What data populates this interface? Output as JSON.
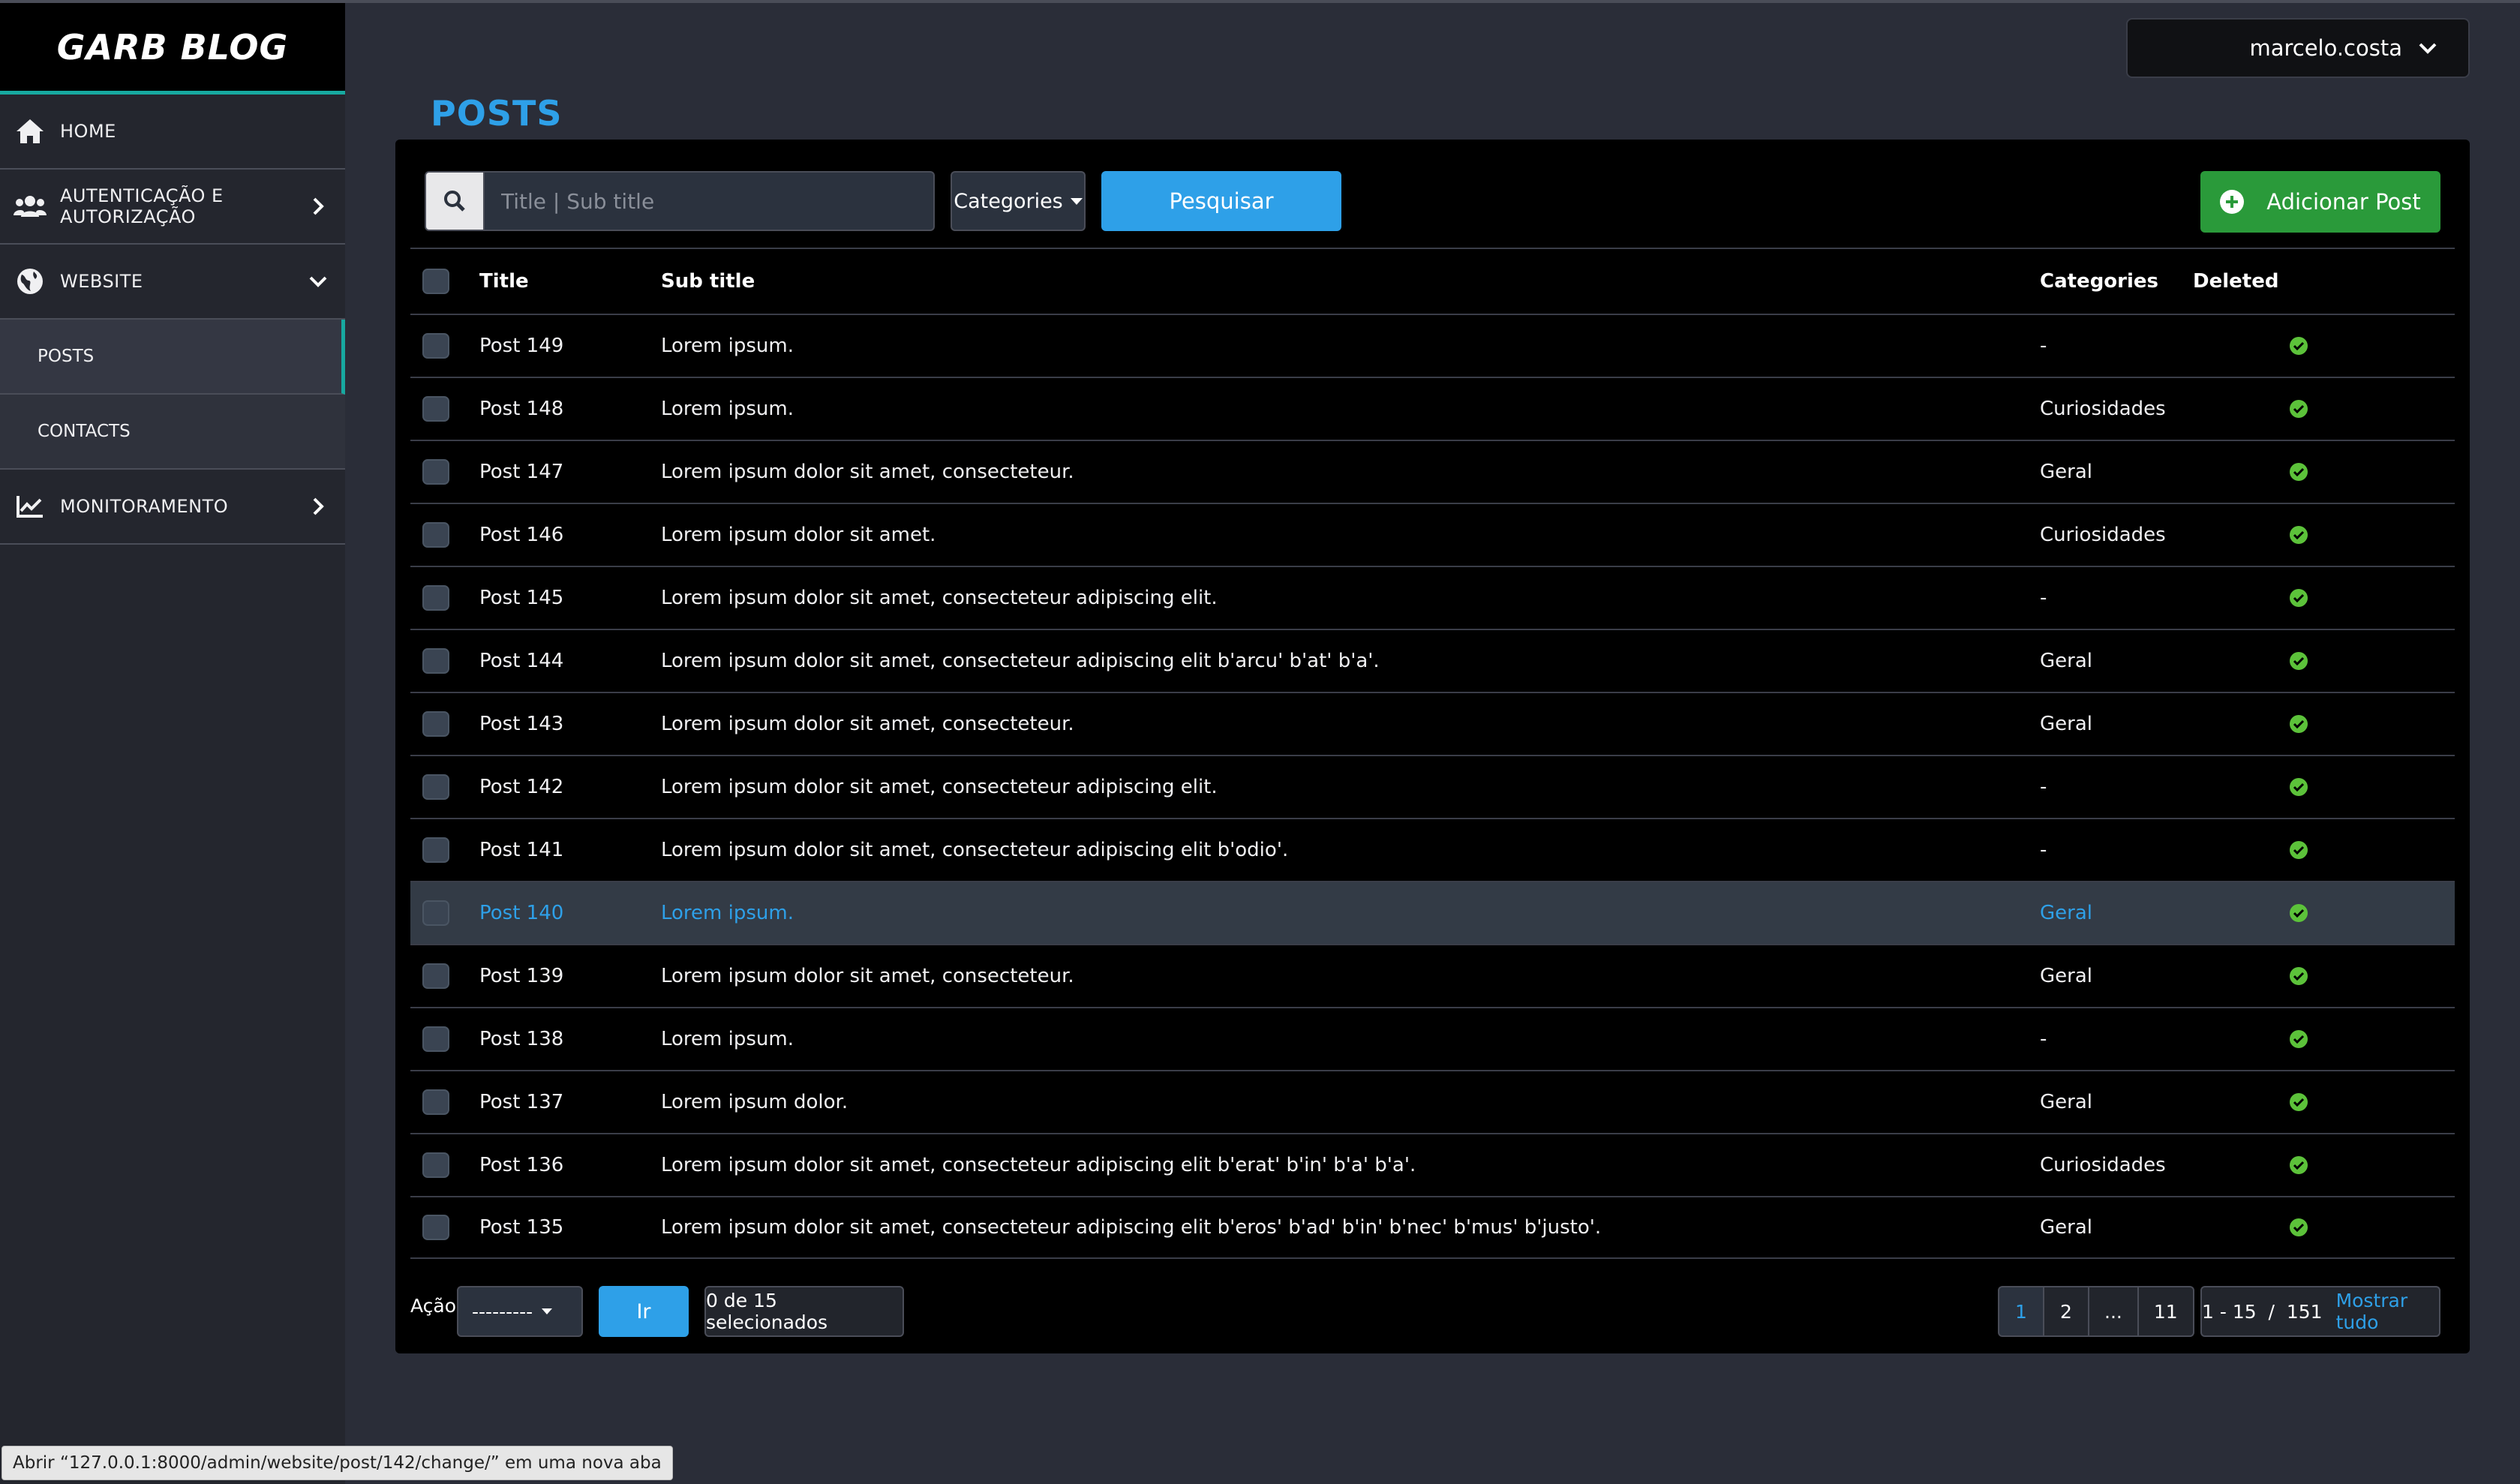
{
  "brand": "GARB BLOG",
  "sidebar": {
    "items": [
      {
        "label": "HOME",
        "icon": "home-icon"
      },
      {
        "label": "AUTENTICAÇÃO E AUTORIZAÇÃO",
        "icon": "users-icon"
      },
      {
        "label": "WEBSITE",
        "icon": "globe-icon"
      },
      {
        "label": "MONITORAMENTO",
        "icon": "chart-line-icon"
      }
    ],
    "website_sub": [
      {
        "label": "POSTS",
        "active": true
      },
      {
        "label": "CONTACTS",
        "active": false
      }
    ]
  },
  "user": {
    "name": "marcelo.costa"
  },
  "page_title": "POSTS",
  "toolbar": {
    "search_placeholder": "Title | Sub title",
    "categories_label": "Categories",
    "search_button": "Pesquisar",
    "add_button": "Adicionar Post"
  },
  "table": {
    "headers": {
      "title": "Title",
      "subtitle": "Sub title",
      "categories": "Categories",
      "deleted": "Deleted"
    },
    "rows": [
      {
        "title": "Post 149",
        "subtitle": "Lorem ipsum.",
        "category": "-"
      },
      {
        "title": "Post 148",
        "subtitle": "Lorem ipsum.",
        "category": "Curiosidades"
      },
      {
        "title": "Post 147",
        "subtitle": "Lorem ipsum dolor sit amet, consecteteur.",
        "category": "Geral"
      },
      {
        "title": "Post 146",
        "subtitle": "Lorem ipsum dolor sit amet.",
        "category": "Curiosidades"
      },
      {
        "title": "Post 145",
        "subtitle": "Lorem ipsum dolor sit amet, consecteteur adipiscing elit.",
        "category": "-"
      },
      {
        "title": "Post 144",
        "subtitle": "Lorem ipsum dolor sit amet, consecteteur adipiscing elit b'arcu' b'at' b'a'.",
        "category": "Geral"
      },
      {
        "title": "Post 143",
        "subtitle": "Lorem ipsum dolor sit amet, consecteteur.",
        "category": "Geral"
      },
      {
        "title": "Post 142",
        "subtitle": "Lorem ipsum dolor sit amet, consecteteur adipiscing elit.",
        "category": "-"
      },
      {
        "title": "Post 141",
        "subtitle": "Lorem ipsum dolor sit amet, consecteteur adipiscing elit b'odio'.",
        "category": "-"
      },
      {
        "title": "Post 140",
        "subtitle": "Lorem ipsum.",
        "category": "Geral",
        "highlight": true
      },
      {
        "title": "Post 139",
        "subtitle": "Lorem ipsum dolor sit amet, consecteteur.",
        "category": "Geral"
      },
      {
        "title": "Post 138",
        "subtitle": "Lorem ipsum.",
        "category": "-"
      },
      {
        "title": "Post 137",
        "subtitle": "Lorem ipsum dolor.",
        "category": "Geral"
      },
      {
        "title": "Post 136",
        "subtitle": "Lorem ipsum dolor sit amet, consecteteur adipiscing elit b'erat' b'in' b'a' b'a'.",
        "category": "Curiosidades"
      },
      {
        "title": "Post 135",
        "subtitle": "Lorem ipsum dolor sit amet, consecteteur adipiscing elit b'eros' b'ad' b'in' b'nec' b'mus' b'justo'.",
        "category": "Geral"
      }
    ]
  },
  "footer": {
    "action_label": "Ação:",
    "action_value": "---------",
    "go_button": "Ir",
    "selected_count": "0 de 15 selecionados",
    "pages": [
      "1",
      "2",
      "...",
      "11"
    ],
    "active_page": "1",
    "range": "1 - 15  /  151",
    "show_all": "Mostrar tudo"
  },
  "status_bar": "Abrir “127.0.0.1:8000/admin/website/post/142/change/” em uma nova aba",
  "colors": {
    "accent": "#2ea0e8",
    "brand_teal": "#17a9a0",
    "success": "#2a9a3a",
    "check_green": "#5cc23a"
  }
}
